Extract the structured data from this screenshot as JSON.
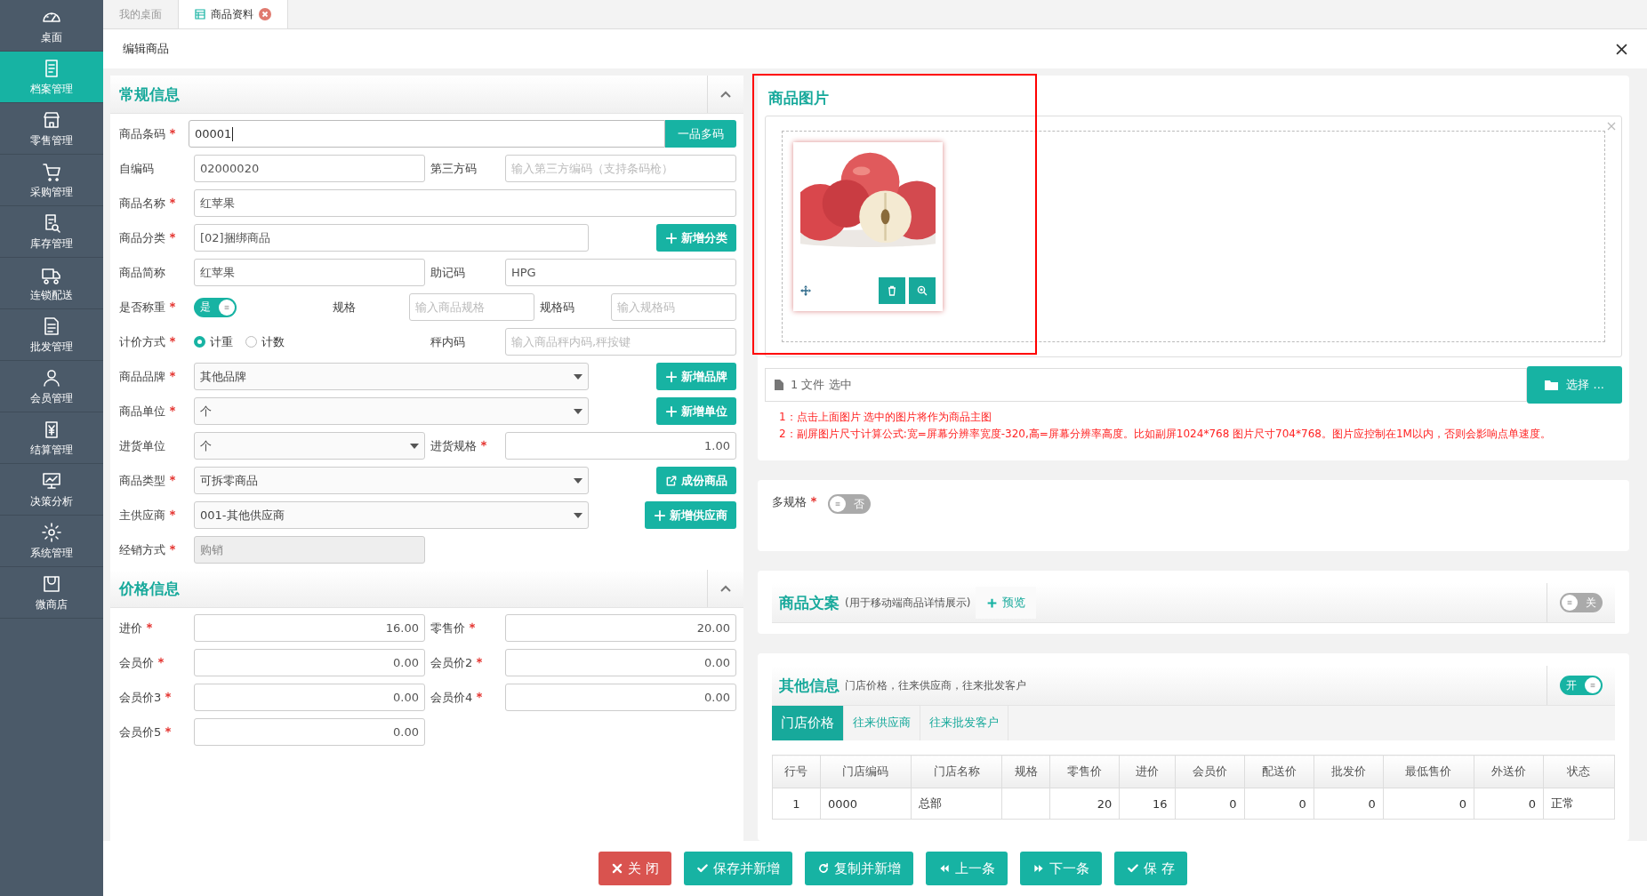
{
  "tabs": [
    {
      "label": "我的桌面",
      "selected": false,
      "closable": false
    },
    {
      "label": "商品资料",
      "selected": true,
      "closable": true
    }
  ],
  "sidebar": {
    "items": [
      {
        "label": "桌面",
        "selected": false
      },
      {
        "label": "档案管理",
        "selected": true
      },
      {
        "label": "零售管理",
        "selected": false
      },
      {
        "label": "采购管理",
        "selected": false
      },
      {
        "label": "库存管理",
        "selected": false
      },
      {
        "label": "连锁配送",
        "selected": false
      },
      {
        "label": "批发管理",
        "selected": false
      },
      {
        "label": "会员管理",
        "selected": false
      },
      {
        "label": "结算管理",
        "selected": false
      },
      {
        "label": "决策分析",
        "selected": false
      },
      {
        "label": "系统管理",
        "selected": false
      },
      {
        "label": "微商店",
        "selected": false
      }
    ]
  },
  "page_title": "编辑商品",
  "general": {
    "title": "常规信息",
    "rows": [
      {
        "kind": "addon",
        "fields": [
          {
            "label": "商品条码",
            "required": true,
            "control": {
              "kind": "input",
              "value": "00001",
              "focused": true
            }
          }
        ],
        "button": {
          "label": "一品多码",
          "kind": "plain"
        }
      },
      {
        "kind": "pair",
        "fields": [
          {
            "label": "自编码",
            "required": false,
            "control": {
              "kind": "input",
              "value": "02000020"
            }
          },
          {
            "label": "第三方码",
            "required": false,
            "control": {
              "kind": "input",
              "placeholder": "输入第三方编码（支持条码枪）"
            }
          }
        ]
      },
      {
        "kind": "single",
        "fields": [
          {
            "label": "商品名称",
            "required": true,
            "control": {
              "kind": "input",
              "value": "红苹果"
            }
          }
        ]
      },
      {
        "kind": "button",
        "fields": [
          {
            "label": "商品分类",
            "required": true,
            "control": {
              "kind": "input",
              "value": "[02]捆绑商品"
            }
          }
        ],
        "button": {
          "label": "新增分类",
          "kind": "add"
        }
      },
      {
        "kind": "pair",
        "fields": [
          {
            "label": "商品简称",
            "required": false,
            "control": {
              "kind": "input",
              "value": "红苹果"
            }
          },
          {
            "label": "助记码",
            "required": false,
            "control": {
              "kind": "input",
              "value": "HPG"
            }
          }
        ]
      },
      {
        "kind": "triple",
        "fields": [
          {
            "label": "是否称重",
            "required": true,
            "control": {
              "kind": "toggle",
              "on": true,
              "label": "是"
            }
          },
          {
            "label": "规格",
            "required": false,
            "control": {
              "kind": "input",
              "placeholder": "输入商品规格"
            }
          },
          {
            "label": "规格码",
            "required": false,
            "control": {
              "kind": "input",
              "placeholder": "输入规格码"
            }
          }
        ]
      },
      {
        "kind": "pair",
        "fields": [
          {
            "label": "计价方式",
            "required": true,
            "control": {
              "kind": "radio",
              "options": [
                {
                  "label": "计重",
                  "selected": true
                },
                {
                  "label": "计数",
                  "selected": false
                }
              ]
            }
          },
          {
            "label": "秤内码",
            "required": false,
            "control": {
              "kind": "input",
              "placeholder": "输入商品秤内码,秤按键"
            }
          }
        ]
      },
      {
        "kind": "button",
        "fields": [
          {
            "label": "商品品牌",
            "required": true,
            "control": {
              "kind": "select",
              "value": "其他品牌"
            }
          }
        ],
        "button": {
          "label": "新增品牌",
          "kind": "add"
        }
      },
      {
        "kind": "button",
        "fields": [
          {
            "label": "商品单位",
            "required": true,
            "control": {
              "kind": "select",
              "value": "个"
            }
          }
        ],
        "button": {
          "label": "新增单位",
          "kind": "add"
        }
      },
      {
        "kind": "pair",
        "fields": [
          {
            "label": "进货单位",
            "required": false,
            "control": {
              "kind": "select",
              "value": "个"
            }
          },
          {
            "label": "进货规格",
            "required": true,
            "control": {
              "kind": "input",
              "value": "1.00",
              "numeric": true
            }
          }
        ]
      },
      {
        "kind": "button",
        "fields": [
          {
            "label": "商品类型",
            "required": true,
            "control": {
              "kind": "select",
              "value": "可拆零商品"
            }
          }
        ],
        "button": {
          "label": "成份商品",
          "kind": "open"
        }
      },
      {
        "kind": "button",
        "fields": [
          {
            "label": "主供应商",
            "required": true,
            "control": {
              "kind": "select",
              "value": "001-其他供应商"
            }
          }
        ],
        "button": {
          "label": "新增供应商",
          "kind": "add"
        }
      },
      {
        "kind": "pair",
        "fields": [
          {
            "label": "经销方式",
            "required": true,
            "control": {
              "kind": "input",
              "value": "购销",
              "disabled": true
            }
          }
        ]
      }
    ]
  },
  "price": {
    "title": "价格信息",
    "rows": [
      {
        "kind": "pair",
        "fields": [
          {
            "label": "进价",
            "required": true,
            "control": {
              "kind": "input",
              "value": "16.00",
              "numeric": true
            }
          },
          {
            "label": "零售价",
            "required": true,
            "control": {
              "kind": "input",
              "value": "20.00",
              "numeric": true
            }
          }
        ]
      },
      {
        "kind": "pair",
        "fields": [
          {
            "label": "会员价",
            "required": true,
            "control": {
              "kind": "input",
              "value": "0.00",
              "numeric": true
            }
          },
          {
            "label": "会员价2",
            "required": true,
            "control": {
              "kind": "input",
              "value": "0.00",
              "numeric": true
            }
          }
        ]
      },
      {
        "kind": "pair",
        "fields": [
          {
            "label": "会员价3",
            "required": true,
            "control": {
              "kind": "input",
              "value": "0.00",
              "numeric": true
            }
          },
          {
            "label": "会员价4",
            "required": true,
            "control": {
              "kind": "input",
              "value": "0.00",
              "numeric": true
            }
          }
        ]
      },
      {
        "kind": "pair",
        "fields": [
          {
            "label": "会员价5",
            "required": true,
            "control": {
              "kind": "input",
              "value": "0.00",
              "numeric": true
            }
          }
        ]
      }
    ]
  },
  "picture_panel": {
    "title": "商品图片",
    "thumbnail": {
      "kind": "picture"
    },
    "file_status": "1 文件 选中",
    "choose_button": "选择 ...",
    "notes": [
      "1：点击上面图片 选中的图片将作为商品主图",
      "2：副屏图片尺寸计算公式:宽=屏幕分辨率宽度-320,高=屏幕分辨率高度。比如副屏1024*768 图片尺寸704*768。图片应控制在1M以内，否则会影响点单速度。"
    ]
  },
  "multi_spec": {
    "label": "多规格",
    "required": true,
    "toggle": {
      "on": false,
      "label": "否"
    }
  },
  "copywriting": {
    "title": "商品文案",
    "subtitle": "(用于移动端商品详情展示)",
    "preview_button": "预览",
    "toggle": {
      "on": false,
      "label": "关"
    }
  },
  "other_info": {
    "title": "其他信息",
    "subtitle": "门店价格，往来供应商，往来批发客户",
    "toggle": {
      "on": true,
      "label": "开"
    },
    "tabs": [
      {
        "label": "门店价格",
        "selected": true
      },
      {
        "label": "往来供应商",
        "selected": false
      },
      {
        "label": "往来批发客户",
        "selected": false
      }
    ],
    "table": {
      "columns": [
        "行号",
        "门店编码",
        "门店名称",
        "规格",
        "零售价",
        "进价",
        "会员价",
        "配送价",
        "批发价",
        "最低售价",
        "外送价",
        "状态"
      ],
      "rows": [
        [
          "1",
          "0000",
          "总部",
          "",
          "20",
          "16",
          "0",
          "0",
          "0",
          "0",
          "0",
          "正常"
        ]
      ]
    }
  },
  "actions": [
    {
      "label": "关 闭",
      "kind": "close"
    },
    {
      "label": "保存并新增",
      "kind": "save"
    },
    {
      "label": "复制并新增",
      "kind": "copy"
    },
    {
      "label": "上一条",
      "kind": "prev"
    },
    {
      "label": "下一条",
      "kind": "next"
    },
    {
      "label": "保 存",
      "kind": "save"
    }
  ]
}
